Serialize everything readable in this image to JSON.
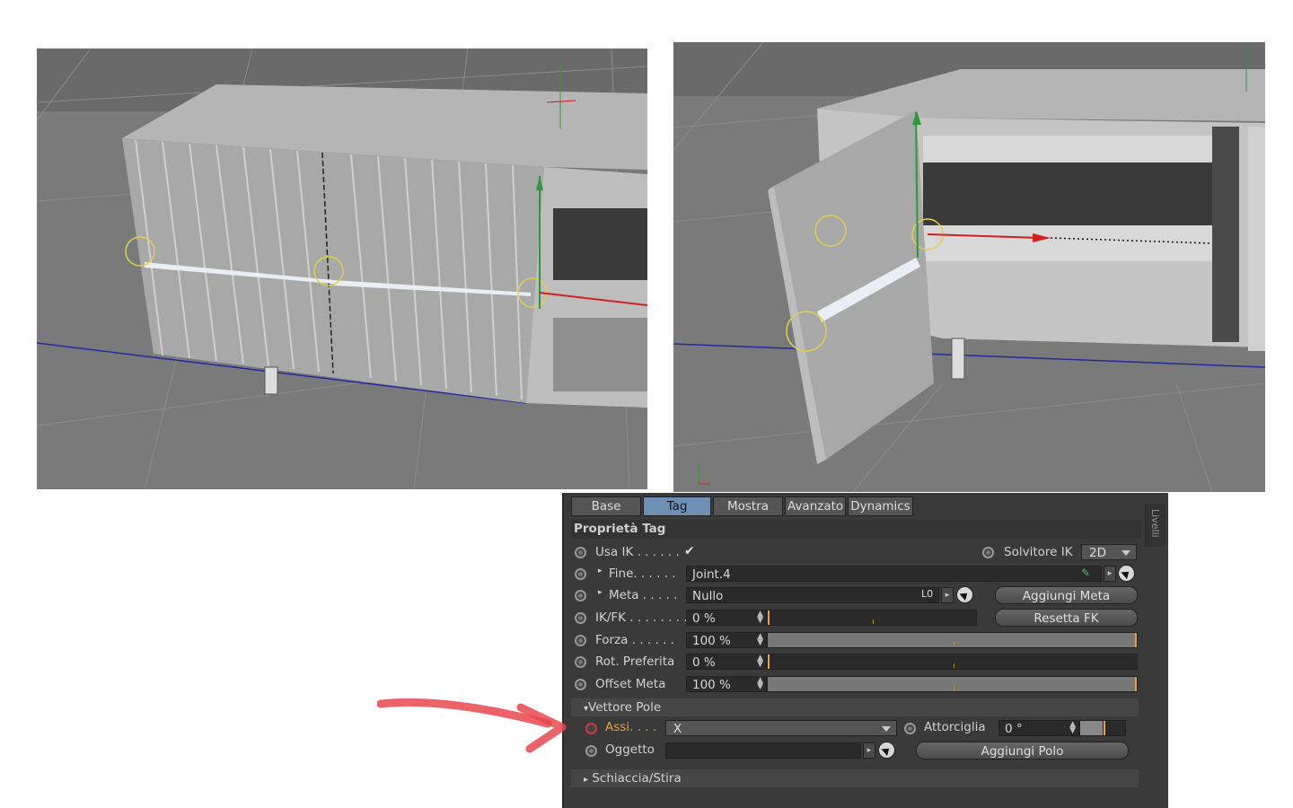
{
  "tabs": [
    "Base",
    "Tag",
    "Mostra",
    "Avanzato",
    "Dynamics"
  ],
  "active_tab": "Tag",
  "side_tab_label": "Livelli",
  "section_title": "Proprietà Tag",
  "rows": {
    "usa_ik": {
      "label": "Usa IK . . . . . .",
      "checked": true,
      "check_glyph": "✔"
    },
    "solvitore": {
      "label": "Solvitore IK",
      "value": "2D"
    },
    "fine": {
      "label": "Fine. . . . . .",
      "value": "Joint.4"
    },
    "meta": {
      "label": "Meta . . . . .",
      "value": "Nullo",
      "button": "Aggiungi Meta"
    },
    "ikfk": {
      "label": "IK/FK . . . . . . . .",
      "value": "0 %",
      "fill": 0.0,
      "button": "Resetta FK"
    },
    "forza": {
      "label": "Forza  . . . . . .",
      "value": "100 %",
      "fill": 1.0
    },
    "rot": {
      "label": "Rot. Preferita",
      "value": "0 %",
      "fill": 0.0
    },
    "offset": {
      "label": "Offset Meta",
      "value": "100 %",
      "fill": 1.0
    }
  },
  "group_pole": "Vettore Pole",
  "pole": {
    "assi": {
      "label": "Assi. . . .",
      "value": "X"
    },
    "attorciglia": {
      "label": "Attorciglia",
      "value": "0 °"
    },
    "oggetto": {
      "label": "Oggetto",
      "value": "",
      "button": "Aggiungi Polo"
    }
  },
  "group_squash": "Schiaccia/Stira",
  "colors": {
    "accent_tab": "#6f8fb5",
    "highlight": "#f0a030",
    "annotation_arrow": "#e8474f"
  },
  "icons": {
    "expand": "▸",
    "collapse": "▾",
    "spin": "⬍",
    "lock": "L0"
  }
}
